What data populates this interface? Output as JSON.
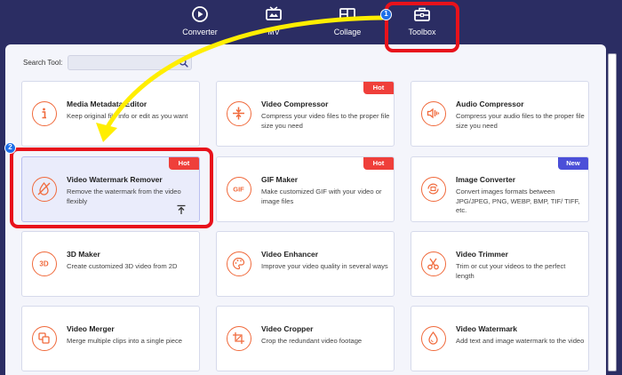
{
  "nav": {
    "items": [
      {
        "label": "Converter",
        "icon": "converter-icon"
      },
      {
        "label": "MV",
        "icon": "mv-icon"
      },
      {
        "label": "Collage",
        "icon": "collage-icon"
      },
      {
        "label": "Toolbox",
        "icon": "toolbox-icon"
      }
    ],
    "active": "Toolbox"
  },
  "annotations": {
    "step1": "1",
    "step2": "2"
  },
  "search": {
    "label": "Search Tool:",
    "value": "",
    "icon": "search-icon"
  },
  "tools": [
    {
      "title": "Media Metadata Editor",
      "desc": "Keep original file info or edit as you want",
      "icon": "info-icon",
      "badge": ""
    },
    {
      "title": "Video Compressor",
      "desc": "Compress your video files to the proper file size you need",
      "icon": "compress-icon",
      "badge": "Hot"
    },
    {
      "title": "Audio Compressor",
      "desc": "Compress your audio files to the proper file size you need",
      "icon": "audio-compress-icon",
      "badge": ""
    },
    {
      "title": "Video Watermark Remover",
      "desc": "Remove the watermark from the video flexibly",
      "icon": "watermark-remove-icon",
      "badge": "Hot",
      "selected": true,
      "pin_icon": "pin-to-top-icon"
    },
    {
      "title": "GIF Maker",
      "desc": "Make customized GIF with your video or image files",
      "icon": "gif-icon",
      "badge": "Hot"
    },
    {
      "title": "Image Converter",
      "desc": "Convert images formats between JPG/JPEG, PNG, WEBP, BMP, TIF/ TIFF, etc.",
      "icon": "image-convert-icon",
      "badge": "New"
    },
    {
      "title": "3D Maker",
      "desc": "Create customized 3D video from 2D",
      "icon": "3d-icon",
      "badge": ""
    },
    {
      "title": "Video Enhancer",
      "desc": "Improve your video quality in several ways",
      "icon": "palette-icon",
      "badge": ""
    },
    {
      "title": "Video Trimmer",
      "desc": "Trim or cut your videos to the perfect length",
      "icon": "scissors-icon",
      "badge": ""
    },
    {
      "title": "Video Merger",
      "desc": "Merge multiple clips into a single piece",
      "icon": "merge-icon",
      "badge": ""
    },
    {
      "title": "Video Cropper",
      "desc": "Crop the redundant video footage",
      "icon": "crop-icon",
      "badge": ""
    },
    {
      "title": "Video Watermark",
      "desc": "Add text and image watermark to the video",
      "icon": "droplet-icon",
      "badge": ""
    }
  ],
  "colors": {
    "nav_bg": "#2b2d63",
    "accent": "#f06a3c",
    "hot": "#ef3f3a",
    "new": "#4b4fd8",
    "highlight": "#e8121b",
    "arrow": "#ffee00",
    "step_badge": "#1e6fe8"
  }
}
